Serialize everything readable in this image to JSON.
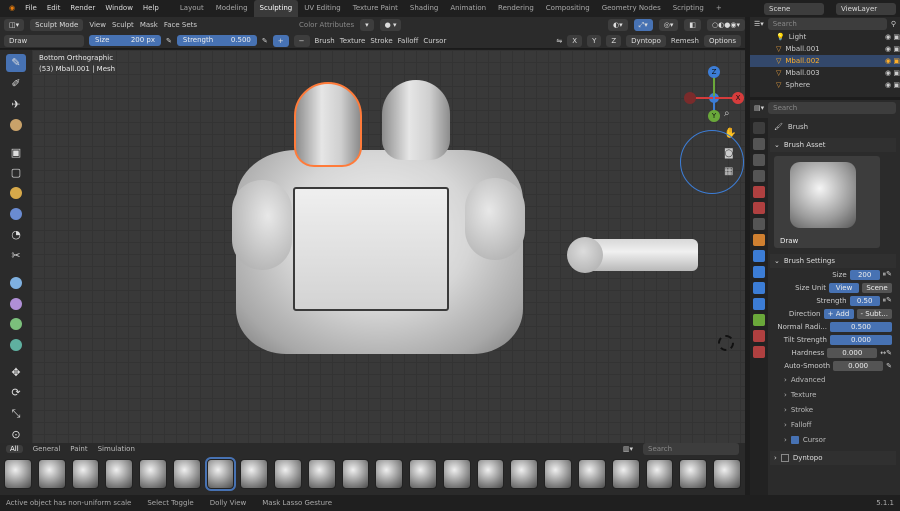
{
  "menu": {
    "items": [
      "File",
      "Edit",
      "Render",
      "Window",
      "Help"
    ],
    "workspaces": [
      "Layout",
      "Modeling",
      "Sculpting",
      "UV Editing",
      "Texture Paint",
      "Shading",
      "Animation",
      "Rendering",
      "Compositing",
      "Geometry Nodes",
      "Scripting",
      "+"
    ],
    "active_workspace": "Sculpting",
    "scene": "Scene",
    "view_layer": "ViewLayer"
  },
  "header": {
    "mode": "Sculpt Mode",
    "view": "View",
    "sculpt": "Sculpt",
    "mask": "Mask",
    "face_sets": "Face Sets",
    "color_attr": "Color Attributes"
  },
  "toolbar": {
    "tool": "Draw",
    "size_label": "Size",
    "size_value": "200 px",
    "strength_label": "Strength",
    "strength_value": "0.500",
    "brush": "Brush",
    "texture": "Texture",
    "stroke": "Stroke",
    "falloff": "Falloff",
    "cursor": "Cursor",
    "x": "X",
    "y": "Y",
    "z": "Z",
    "dyntopo": "Dyntopo",
    "remesh": "Remesh",
    "options": "Options"
  },
  "viewport": {
    "view_name": "Bottom Orthographic",
    "object_info": "(53) Mball.001 | Mesh"
  },
  "gizmo": {
    "x": "X",
    "y": "Y",
    "z": "Z"
  },
  "shelf": {
    "tabs": [
      "All",
      "General",
      "Paint",
      "Simulation"
    ],
    "active_tab": "All",
    "search_placeholder": "Search"
  },
  "status": {
    "items": [
      "Active object has non-uniform scale",
      "Select Toggle",
      "Dolly View",
      "Mask Lasso Gesture"
    ],
    "version": "5.1.1"
  },
  "outliner": {
    "search_placeholder": "Search",
    "items": [
      "Light",
      "Mball.001",
      "Mball.002",
      "Mball.003",
      "Sphere"
    ],
    "selected": "Mball.002"
  },
  "properties": {
    "search_placeholder": "Search",
    "brush_title": "Brush",
    "brush_asset": "Brush Asset",
    "brush_name": "Draw",
    "brush_settings": "Brush Settings",
    "size_label": "Size",
    "size_value": "200",
    "size_unit_label": "Size Unit",
    "view_btn": "View",
    "scene_btn": "Scene",
    "strength_label": "Strength",
    "strength_value": "0.50",
    "direction_label": "Direction",
    "add_btn": "+ Add",
    "subtract_btn": "- Subt...",
    "normal_radius_label": "Normal Radi...",
    "normal_radius_value": "0.500",
    "tilt_label": "Tilt Strength",
    "tilt_value": "0.000",
    "hardness_label": "Hardness",
    "hardness_value": "0.000",
    "autosmooth_label": "Auto-Smooth",
    "autosmooth_value": "0.000",
    "advanced": "Advanced",
    "texture": "Texture",
    "stroke": "Stroke",
    "falloff": "Falloff",
    "cursor": "Cursor",
    "dyntopo": "Dyntopo"
  },
  "colors": {
    "accent": "#4772b3",
    "selected_orange": "#ff7b3a",
    "x_axis": "#d63c3c",
    "y_axis": "#6aa83a",
    "z_axis": "#3c7dd6"
  }
}
